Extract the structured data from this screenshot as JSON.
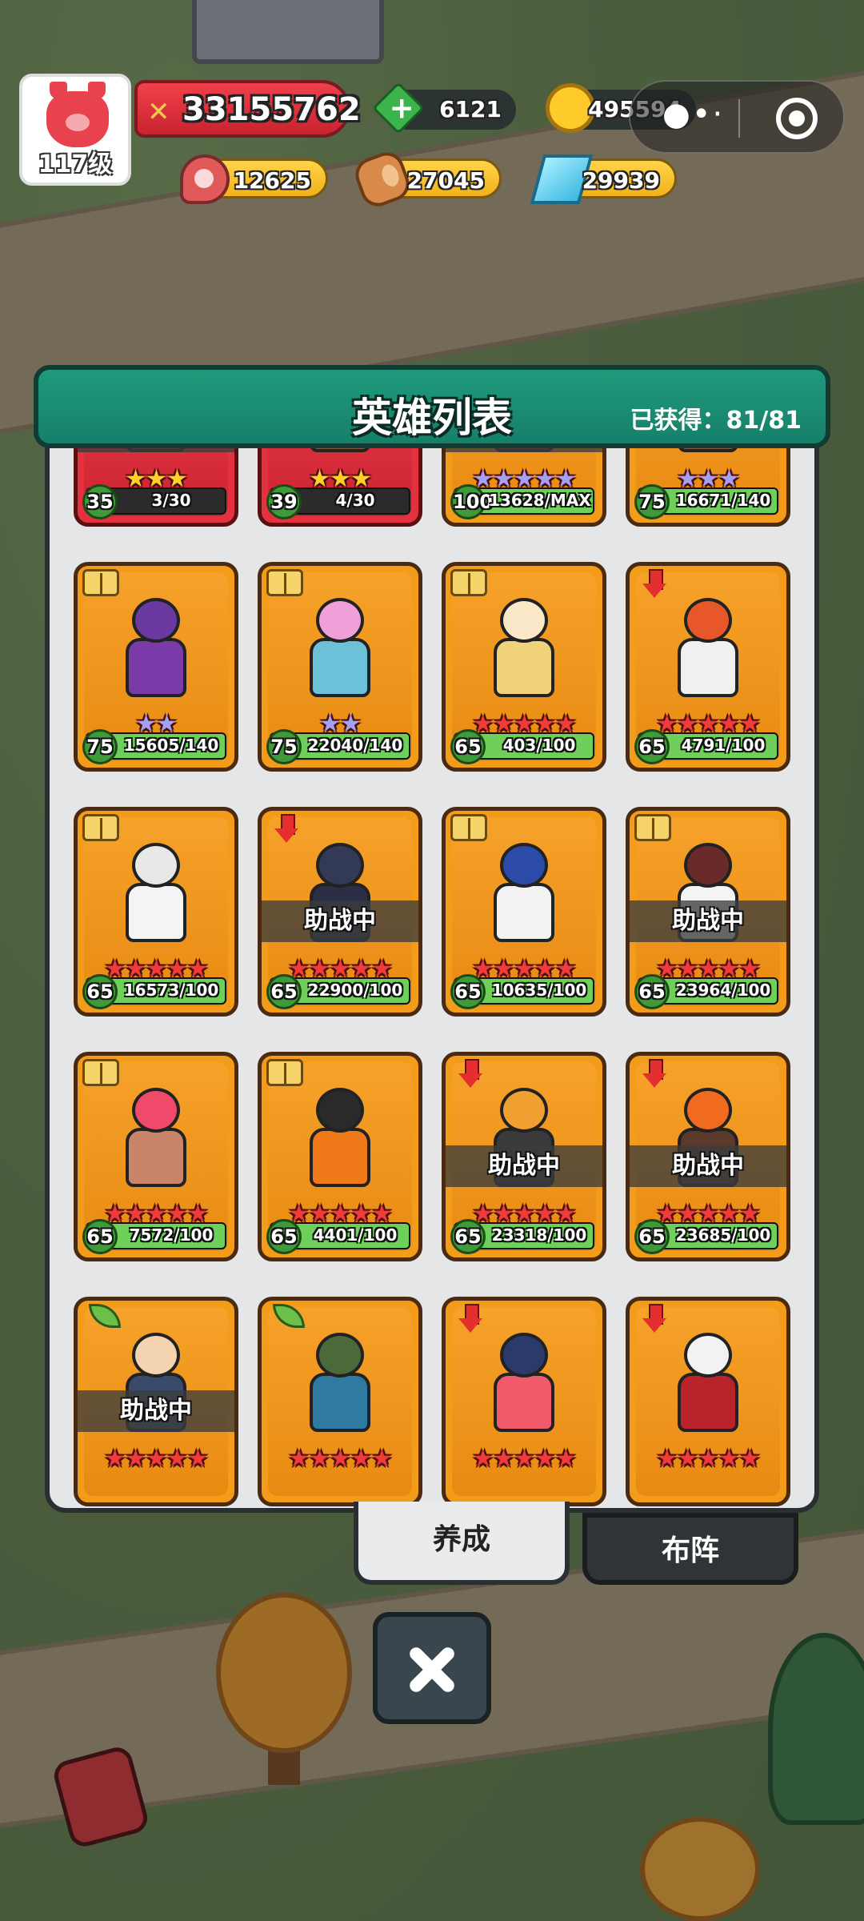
{
  "player": {
    "level_label": "117级",
    "power": "33155762"
  },
  "resources": {
    "gems": "6121",
    "gold": "495594",
    "meat": "12625",
    "wood": "27045",
    "crystal": "29939"
  },
  "panel": {
    "title": "英雄列表",
    "obtained": "已获得：81/81"
  },
  "assist_label": "助战中",
  "heroes": [
    {
      "frame": "red",
      "stars": "★★★",
      "star_color": "gold",
      "level": "35",
      "progress": "3/30",
      "fill": 0.1,
      "assist": true,
      "badge": ""
    },
    {
      "frame": "red",
      "stars": "★★★",
      "star_color": "gold",
      "level": "39",
      "progress": "4/30",
      "fill": 0.13,
      "assist": false,
      "badge": ""
    },
    {
      "frame": "orange",
      "stars": "★★★★★",
      "star_color": "purple",
      "level": "100",
      "progress": "13628/MAX",
      "fill": 1.0,
      "assist": true,
      "badge": ""
    },
    {
      "frame": "orange",
      "stars": "★★★",
      "star_color": "purple",
      "level": "75",
      "progress": "16671/140",
      "fill": 1.0,
      "assist": false,
      "badge": ""
    },
    {
      "frame": "orange",
      "stars": "★★",
      "star_color": "purple",
      "level": "75",
      "progress": "15605/140",
      "fill": 1.0,
      "assist": false,
      "badge": "book",
      "head": "#6a3aa0",
      "body": "#7a3aa8"
    },
    {
      "frame": "orange",
      "stars": "★★",
      "star_color": "purple",
      "level": "75",
      "progress": "22040/140",
      "fill": 1.0,
      "assist": false,
      "badge": "book",
      "head": "#f0a0d8",
      "body": "#6cc0d8"
    },
    {
      "frame": "orange",
      "stars": "★★★★★",
      "star_color": "red",
      "level": "65",
      "progress": "403/100",
      "fill": 1.0,
      "assist": false,
      "badge": "book",
      "head": "#fbe8c8",
      "body": "#f0d27a"
    },
    {
      "frame": "orange",
      "stars": "★★★★★",
      "star_color": "red",
      "level": "65",
      "progress": "4791/100",
      "fill": 1.0,
      "assist": false,
      "badge": "arrow",
      "head": "#e8572a",
      "body": "#f0f0f0"
    },
    {
      "frame": "orange",
      "stars": "★★★★★",
      "star_color": "red",
      "level": "65",
      "progress": "16573/100",
      "fill": 1.0,
      "assist": false,
      "badge": "book",
      "head": "#e8e8e8",
      "body": "#f4f4f4"
    },
    {
      "frame": "orange",
      "stars": "★★★★★",
      "star_color": "red",
      "level": "65",
      "progress": "22900/100",
      "fill": 1.0,
      "assist": true,
      "badge": "arrow",
      "head": "#333a55",
      "body": "#2a2f45"
    },
    {
      "frame": "orange",
      "stars": "★★★★★",
      "star_color": "red",
      "level": "65",
      "progress": "10635/100",
      "fill": 1.0,
      "assist": false,
      "badge": "book",
      "head": "#2c4aa8",
      "body": "#f2f2f2"
    },
    {
      "frame": "orange",
      "stars": "★★★★★",
      "star_color": "red",
      "level": "65",
      "progress": "23964/100",
      "fill": 1.0,
      "assist": true,
      "badge": "book",
      "head": "#6a2a2a",
      "body": "#f4f4f4"
    },
    {
      "frame": "orange",
      "stars": "★★★★★",
      "star_color": "red",
      "level": "65",
      "progress": "7572/100",
      "fill": 1.0,
      "assist": false,
      "badge": "book",
      "head": "#f04a6a",
      "body": "#c9846a"
    },
    {
      "frame": "orange",
      "stars": "★★★★★",
      "star_color": "red",
      "level": "65",
      "progress": "4401/100",
      "fill": 1.0,
      "assist": false,
      "badge": "book",
      "head": "#2a2a2a",
      "body": "#f07a1a"
    },
    {
      "frame": "orange",
      "stars": "★★★★★",
      "star_color": "red",
      "level": "65",
      "progress": "23318/100",
      "fill": 1.0,
      "assist": true,
      "badge": "arrow",
      "head": "#f0a030",
      "body": "#3a3a3a"
    },
    {
      "frame": "orange",
      "stars": "★★★★★",
      "star_color": "red",
      "level": "65",
      "progress": "23685/100",
      "fill": 1.0,
      "assist": true,
      "badge": "arrow",
      "head": "#f06a20",
      "body": "#5a3a2a"
    },
    {
      "frame": "orange",
      "stars": "★★★★★",
      "star_color": "red",
      "level": "",
      "progress": "",
      "fill": 0,
      "assist": true,
      "badge": "leaf",
      "head": "#f4d4b0",
      "body": "#3a4a6a"
    },
    {
      "frame": "orange",
      "stars": "★★★★★",
      "star_color": "red",
      "level": "",
      "progress": "",
      "fill": 0,
      "assist": false,
      "badge": "leaf",
      "head": "#4a6a3a",
      "body": "#2f7aa0"
    },
    {
      "frame": "orange",
      "stars": "★★★★★",
      "star_color": "red",
      "level": "",
      "progress": "",
      "fill": 0,
      "assist": false,
      "badge": "arrow",
      "head": "#2a3a6a",
      "body": "#f05a6a"
    },
    {
      "frame": "orange",
      "stars": "★★★★★",
      "star_color": "red",
      "level": "",
      "progress": "",
      "fill": 0,
      "assist": false,
      "badge": "arrow",
      "head": "#f2f2f2",
      "body": "#b8242a"
    }
  ],
  "tabs": {
    "train": "养成",
    "formation": "布阵"
  },
  "icons": {
    "power": "crossed-swords-icon",
    "gems": "green-gem-icon",
    "gold": "gold-coin-icon",
    "meat": "meat-icon",
    "wood": "wood-log-icon",
    "crystal": "crystal-icon",
    "more": "more-dots-icon",
    "target": "target-icon",
    "close": "close-icon"
  },
  "colors": {
    "header": "#1f9a7b",
    "card_orange": "#f39c1a",
    "card_red": "#e3323e"
  }
}
